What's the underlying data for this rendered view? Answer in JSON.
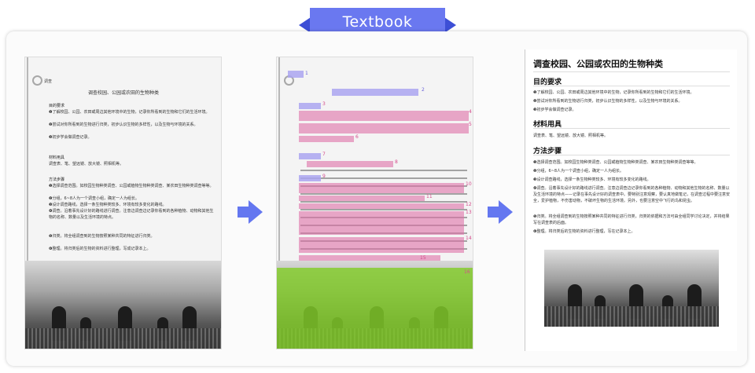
{
  "header": {
    "tag": "Textbook"
  },
  "page1": {
    "icon_label": "调查",
    "title": "调查校园、公园或农田的生物种类",
    "sections": [
      {
        "heading": "目的要求",
        "rows": [
          "❶了解校园、公园、农田或周边其他环境中的生物，记录你所看到的生物和它们的生活环境。",
          "❷尝试对你所看到的生物进行归类，初步认识生物的多样性，以及生物与环境的关系。",
          "❸初步学会做调查记录。"
        ]
      },
      {
        "heading": "材料用具",
        "rows": [
          "调查表、笔、望远镜、放大镜、照相机等。"
        ]
      },
      {
        "heading": "方法步骤",
        "rows": [
          "❶选择调查范围。如校园生物种类调查、公园或植物生物种类调查、某农田生物种类调查等等。",
          "❷分组，6~8人为一个调查小组，确定一人为组长。",
          "❸设计调查路线，选择一条生物种类较多、环境有较多变化的路线。",
          "❹调查。沿着事先设计好的路线进行调查。注意边调查边记录你看到的各种植物、动物和其他生物的名称、数量以及生活环境的特点。",
          "❺归类。将全组调查到的生物按照某种共同的特征进行归类。",
          "❻整理。将归类后的生物的资料进行整理，写成记录本上。"
        ]
      }
    ]
  },
  "page2": {
    "title_num": "2",
    "blocks": [
      {
        "kind": "title",
        "num": "1"
      },
      {
        "kind": "title",
        "num": "3"
      },
      {
        "kind": "text",
        "num": "4"
      },
      {
        "kind": "text",
        "num": "5"
      },
      {
        "kind": "text",
        "num": "6"
      },
      {
        "kind": "title",
        "num": "7"
      },
      {
        "kind": "text",
        "num": "8"
      },
      {
        "kind": "title",
        "num": "9"
      },
      {
        "kind": "text",
        "num": "10"
      },
      {
        "kind": "text",
        "num": "11"
      },
      {
        "kind": "text",
        "num": "12"
      },
      {
        "kind": "text",
        "num": "13"
      },
      {
        "kind": "text",
        "num": "14"
      },
      {
        "kind": "text",
        "num": "15"
      },
      {
        "kind": "figure",
        "num": "16"
      }
    ]
  },
  "page3": {
    "title": "调查校园、公园或农田的生物种类",
    "sections": [
      {
        "heading": "目的要求",
        "paras": [
          "❶了解校园、公园、农田或周边其他环境中的生物，记录你所看到的生物和它们的生活环境。",
          "❷尝试对你所看到的生物进行归类，初步认识生物的多样性，以及生物与环境的关系。",
          "❸初步学会做调查记录。"
        ]
      },
      {
        "heading": "材料用具",
        "paras": [
          "调查表、笔、望远镜、放大镜、照相机等。"
        ]
      },
      {
        "heading": "方法步骤",
        "paras": [
          "❶选择调查范围。如校园生物种类调查、公园或植物生物种类调查、某农田生物种类调查等等。",
          "❷分组，6~8人为一个调查小组，确定一人为组长。",
          "❸设计调查路线，选择一条生物种类较多、环境有较多变化的路线。",
          "❹调查。沿着事先设计好的路线进行调查。注意边调查边记录你看到的各种植物、动物和其他生物的名称、数量以及生活环境的特点——记录在事先设计好的调查表中。要特别注意观察，要认真地做笔记，在调查过程中要注意安全，爱护植物，不伤害动物，不破坏生物的生活环境。另外，也要注意空中飞行的鸟和昆虫。",
          "❺归类。将全组调查到的生物按照某种共同的特征进行归类，归类的依据和方法可由全组同学讨论决定，并将结果写在调查表的后面。",
          "❻整理。将归类后的生物的资料进行整理，写在记录本上。"
        ]
      }
    ]
  }
}
